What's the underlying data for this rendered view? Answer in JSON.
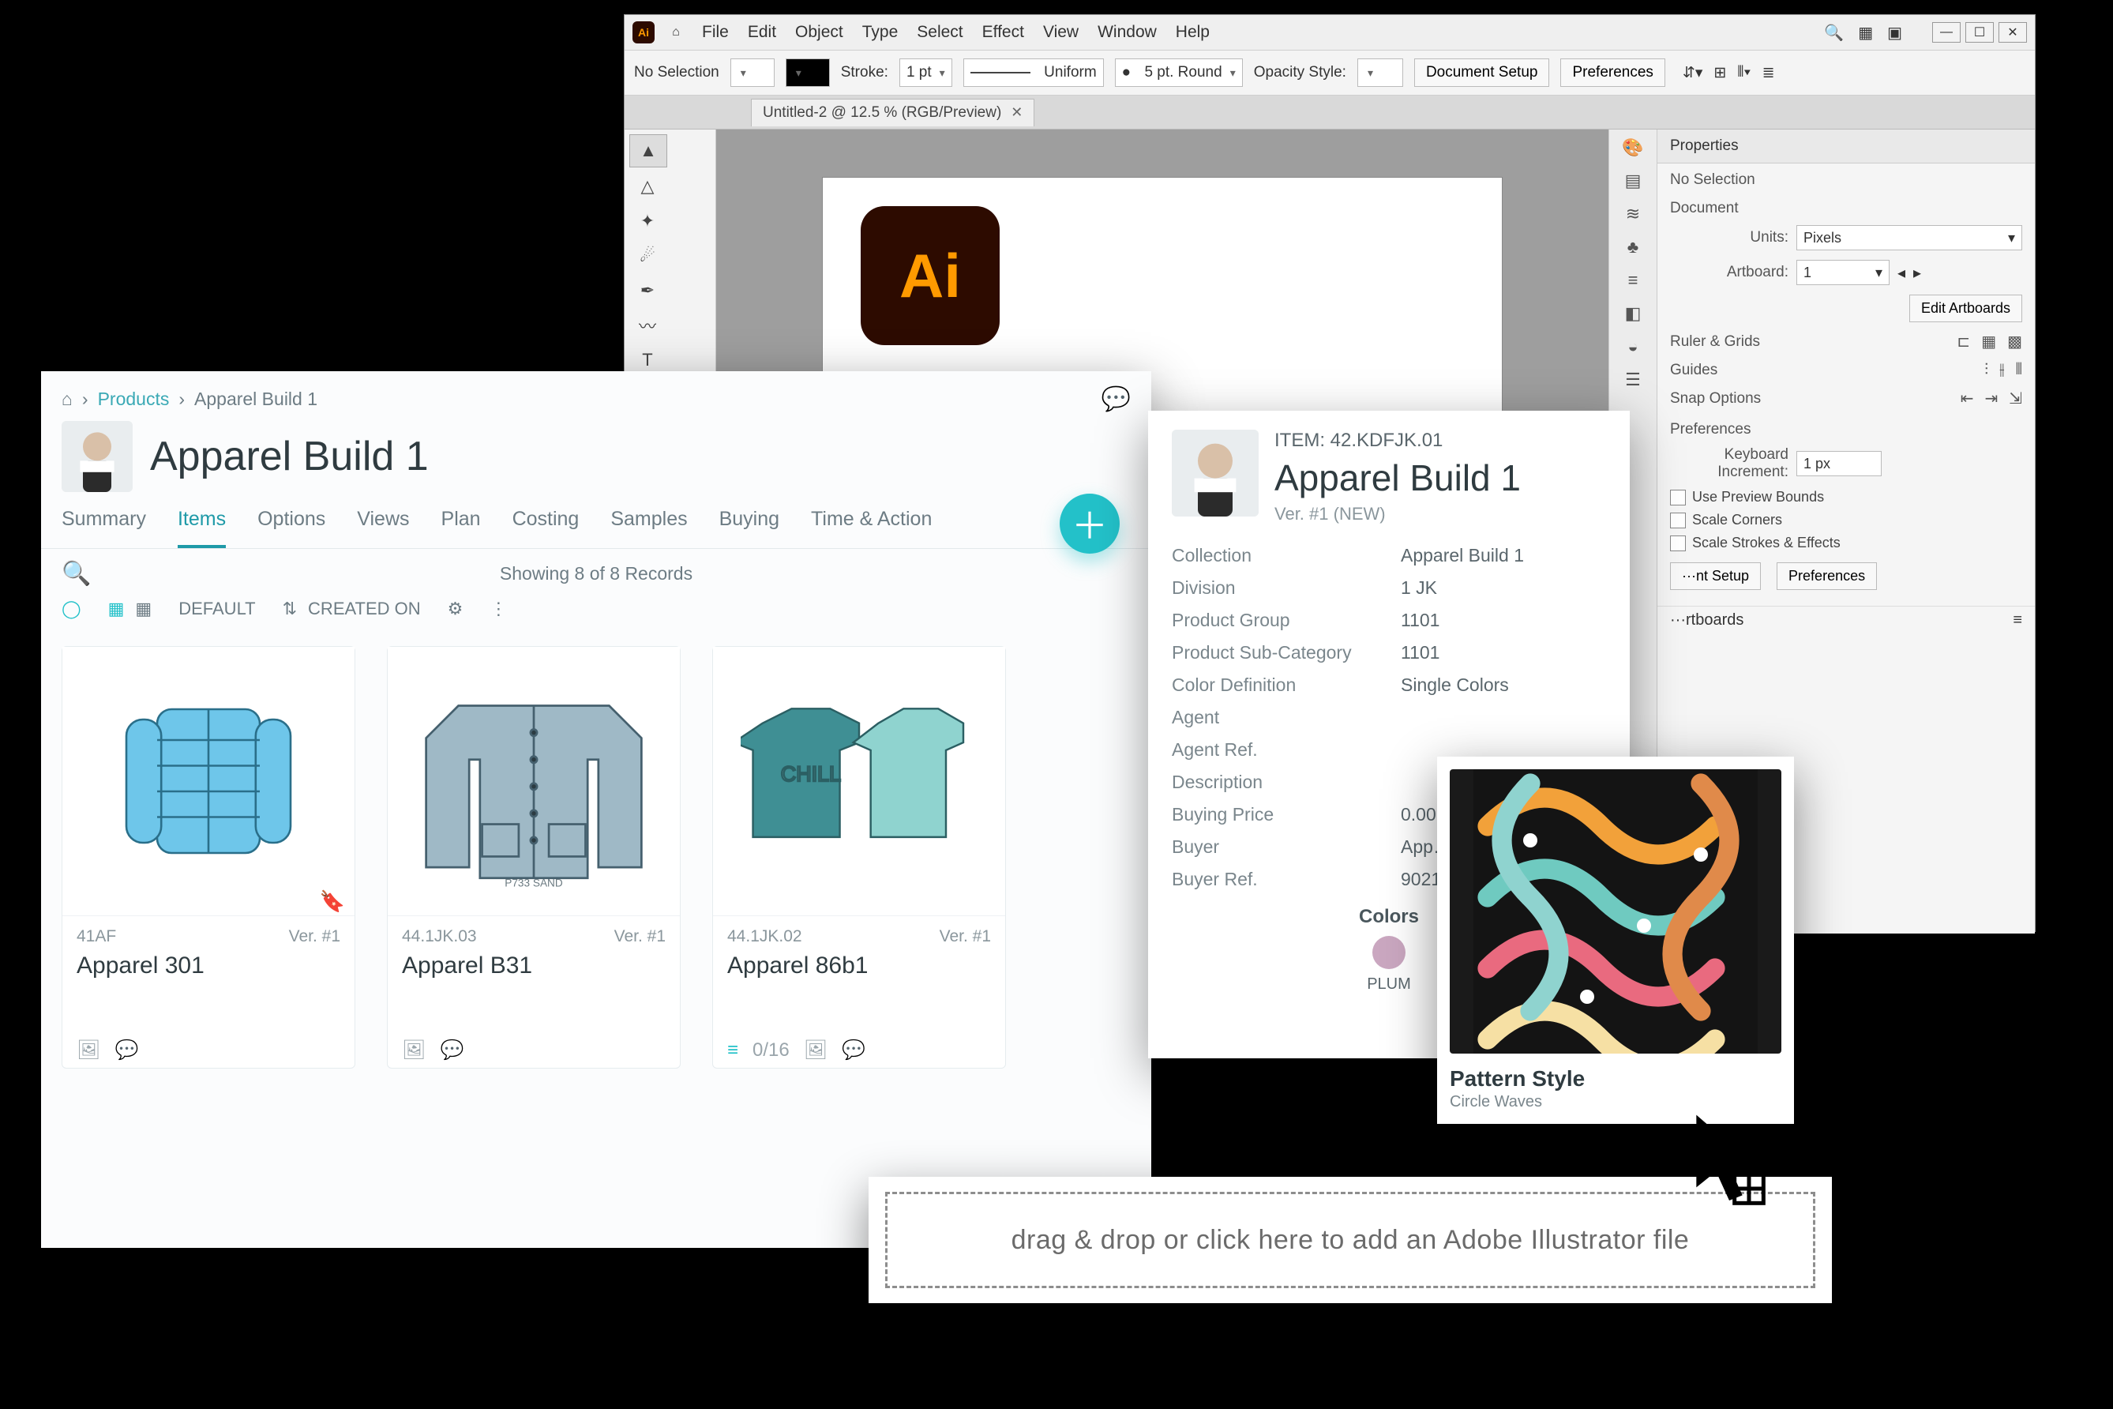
{
  "illustrator": {
    "menu": [
      "File",
      "Edit",
      "Object",
      "Type",
      "Select",
      "Effect",
      "View",
      "Window",
      "Help"
    ],
    "optbar": {
      "selection": "No Selection",
      "stroke_label": "Stroke:",
      "stroke_value": "1 pt",
      "line_style": "Uniform",
      "cap": "5 pt. Round",
      "opacity_label": "Opacity Style:",
      "doc_setup": "Document Setup",
      "prefs": "Preferences"
    },
    "tab": "Untitled-2 @ 12.5 % (RGB/Preview)",
    "props": {
      "panel_title": "Properties",
      "no_selection": "No Selection",
      "section_document": "Document",
      "units_label": "Units:",
      "units_value": "Pixels",
      "artboards_label": "Artboard:",
      "artboards_value": "1",
      "edit_artboards": "Edit Artboards",
      "ruler_grids": "Ruler & Grids",
      "guides": "Guides",
      "snap": "Snap Options",
      "preferences": "Preferences",
      "keyboard_inc_label": "Keyboard Increment:",
      "keyboard_inc_value": "1 px",
      "check_preview": "Use Preview Bounds",
      "check_scale_corners": "Scale Corners",
      "check_scale_strokes": "Scale Strokes & Effects",
      "doc_setup2": "···nt Setup",
      "prefs2": "Preferences",
      "artboards2": "···rtboards"
    }
  },
  "plm": {
    "breadcrumb": {
      "home": "⌂",
      "products": "Products",
      "current": "Apparel Build 1"
    },
    "title": "Apparel Build 1",
    "tabs": [
      "Summary",
      "Items",
      "Options",
      "Views",
      "Plan",
      "Costing",
      "Samples",
      "Buying",
      "Time & Action"
    ],
    "active_tab": "Items",
    "showing": "Showing 8 of 8 Records",
    "filters": {
      "default": "DEFAULT",
      "created_on": "CREATED ON"
    },
    "cards": [
      {
        "sku": "41AF",
        "ver": "Ver. #1",
        "name": "Apparel 301"
      },
      {
        "sku": "44.1JK.03",
        "ver": "Ver. #1",
        "name": "Apparel B31"
      },
      {
        "sku": "44.1JK.02",
        "ver": "Ver. #1",
        "name": "Apparel 86b1",
        "progress": "0/16"
      }
    ]
  },
  "detail": {
    "item_code": "ITEM: 42.KDFJK.01",
    "title": "Apparel Build 1",
    "ver": "Ver. #1 (NEW)",
    "rows": [
      {
        "k": "Collection",
        "v": "Apparel Build 1"
      },
      {
        "k": "Division",
        "v": "1 JK"
      },
      {
        "k": "Product Group",
        "v": "1101"
      },
      {
        "k": "Product Sub-Category",
        "v": "1101"
      },
      {
        "k": "Color Definition",
        "v": "Single Colors"
      },
      {
        "k": "Agent",
        "v": ""
      },
      {
        "k": "Agent Ref.",
        "v": ""
      },
      {
        "k": "Description",
        "v": ""
      },
      {
        "k": "Buying Price",
        "v": "0.00"
      },
      {
        "k": "Buyer",
        "v": "App…"
      },
      {
        "k": "Buyer Ref.",
        "v": "9021"
      }
    ],
    "colors_heading": "Colors",
    "swatch": {
      "label": "PLUM",
      "hex": "#caa7c0"
    }
  },
  "pattern": {
    "title": "Pattern Style",
    "subtitle": "Circle Waves"
  },
  "dropzone": {
    "text": "drag & drop or click here to add an Adobe Illustrator file"
  }
}
